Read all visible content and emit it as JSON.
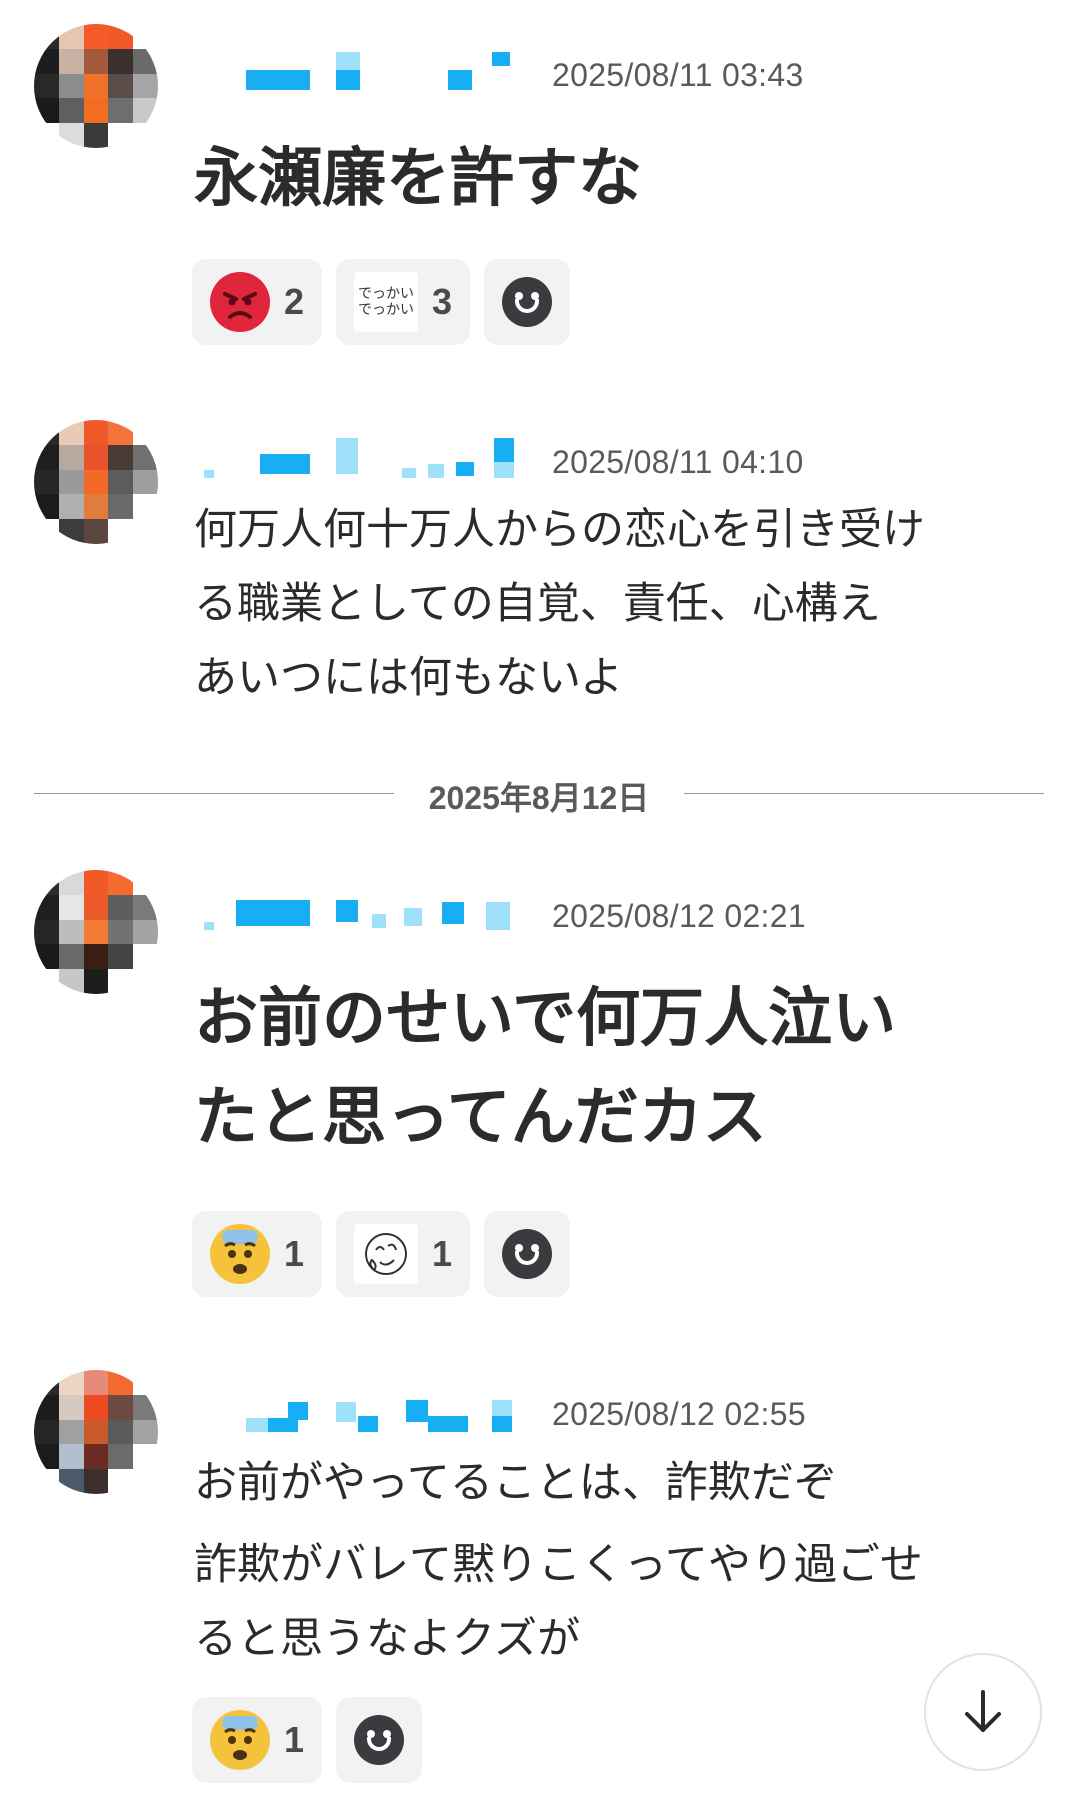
{
  "divider_label": "2025年8月12日",
  "messages": [
    {
      "timestamp": "2025/08/11 03:43",
      "text": "永瀬廉を許すな",
      "reactions": [
        {
          "icon": "angry-face-icon",
          "count": "2"
        },
        {
          "icon": "sticker-dekkai-icon",
          "sticker_text": "でっかい でっかい",
          "count": "3"
        },
        {
          "icon": "add-reaction-icon"
        }
      ]
    },
    {
      "timestamp": "2025/08/11 04:10",
      "text": "何万人何十万人からの恋心を引き受ける職業としての自覚、責任、心構え あいつには何もないよ",
      "lines": [
        "何万人何十万人からの恋心を引き受け",
        "る職業としての自覚、責任、心構え",
        "あいつには何もないよ"
      ]
    },
    {
      "timestamp": "2025/08/12 02:21",
      "text": "お前のせいで何万人泣いたと思ってんだカス",
      "lines": [
        "お前のせいで何万人泣い",
        "たと思ってんだカス"
      ],
      "reactions": [
        {
          "icon": "anxious-face-icon",
          "count": "1"
        },
        {
          "icon": "doodle-sticker-icon",
          "count": "1"
        },
        {
          "icon": "add-reaction-icon"
        }
      ]
    },
    {
      "timestamp": "2025/08/12 02:55",
      "text": "お前がやってることは、詐欺だぞ 詐欺がバレて黙りこくってやり過ごせると思うなよクズが",
      "lines": [
        "お前がやってることは、詐欺だぞ",
        "詐欺がバレて黙りこくってやり過ごせ",
        "ると思うなよクズが"
      ],
      "reactions": [
        {
          "icon": "anxious-face-icon",
          "count": "1"
        },
        {
          "icon": "add-reaction-icon"
        }
      ]
    }
  ],
  "colors": {
    "name_blur": "#17aef4",
    "reaction_bg": "#f2f2f2",
    "angry": "#e0263b",
    "anxious": "#f5c33b"
  },
  "scroll_button": {
    "icon": "arrow-down-icon"
  }
}
